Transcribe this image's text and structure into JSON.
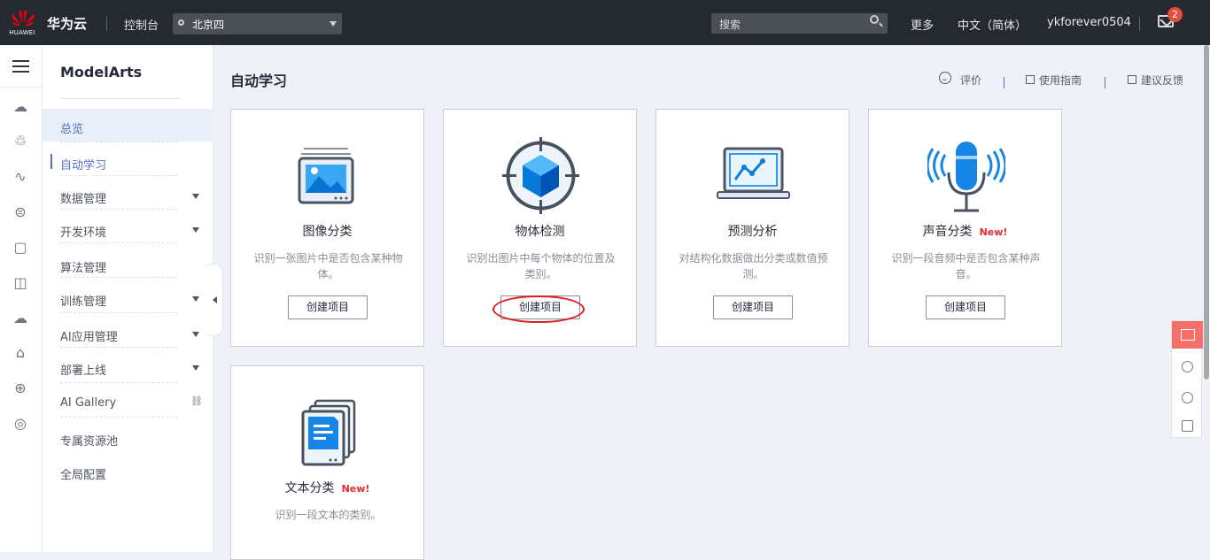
{
  "topbar": {
    "logo_text": "HUAWEI",
    "brand": "华为云",
    "console": "控制台",
    "region": "北京四",
    "search_placeholder": "搜索",
    "links": [
      "更多",
      "中文（简体）",
      "ykforever0504"
    ],
    "badge_count": "2"
  },
  "sidebar": {
    "title": "ModelArts",
    "items": [
      {
        "label": "总览",
        "state": "selected"
      },
      {
        "label": "自动学习",
        "state": "active"
      },
      {
        "label": "数据管理",
        "expandable": true
      },
      {
        "label": "开发环境",
        "expandable": true
      },
      {
        "label": "算法管理"
      },
      {
        "label": "训练管理",
        "expandable": true
      },
      {
        "label": "AI应用管理",
        "expandable": true
      },
      {
        "label": "部署上线",
        "expandable": true
      },
      {
        "label": "AI Gallery",
        "external_link": true
      },
      {
        "label": "专属资源池"
      },
      {
        "label": "全局配置"
      }
    ]
  },
  "main": {
    "title": "自动学习",
    "toolbar": {
      "rate": "评价",
      "guide": "使用指南",
      "feedback": "建议反馈"
    },
    "cards": [
      {
        "title": "图像分类",
        "desc": "识别一张图片中是否包含某种物体。",
        "button": "创建项目",
        "new": ""
      },
      {
        "title": "物体检测",
        "desc": "识别出图片中每个物体的位置及类别。",
        "button": "创建项目",
        "new": ""
      },
      {
        "title": "预测分析",
        "desc": "对结构化数据做出分类或数值预测。",
        "button": "创建项目",
        "new": ""
      },
      {
        "title": "声音分类",
        "desc": "识别一段音频中是否包含某种声音。",
        "button": "创建项目",
        "new": "New!"
      },
      {
        "title": "文本分类",
        "desc": "识别一段文本的类别。",
        "button": "",
        "new": "New!"
      }
    ]
  },
  "icons": {
    "rail": [
      "cloud-icon",
      "cluster-icon",
      "network-icon",
      "storage-icon",
      "database-icon",
      "monitor-icon",
      "cloud-service-icon",
      "route-icon",
      "globe-icon",
      "ip-icon"
    ],
    "floating": [
      "chat-icon",
      "smile-icon",
      "help-icon",
      "edit-icon"
    ]
  },
  "colors": {
    "topbar": "#252a31",
    "accent": "#526ecc",
    "new_badge": "#e12d32",
    "highlight": "#d92020",
    "float_active": "#f66f6a"
  }
}
